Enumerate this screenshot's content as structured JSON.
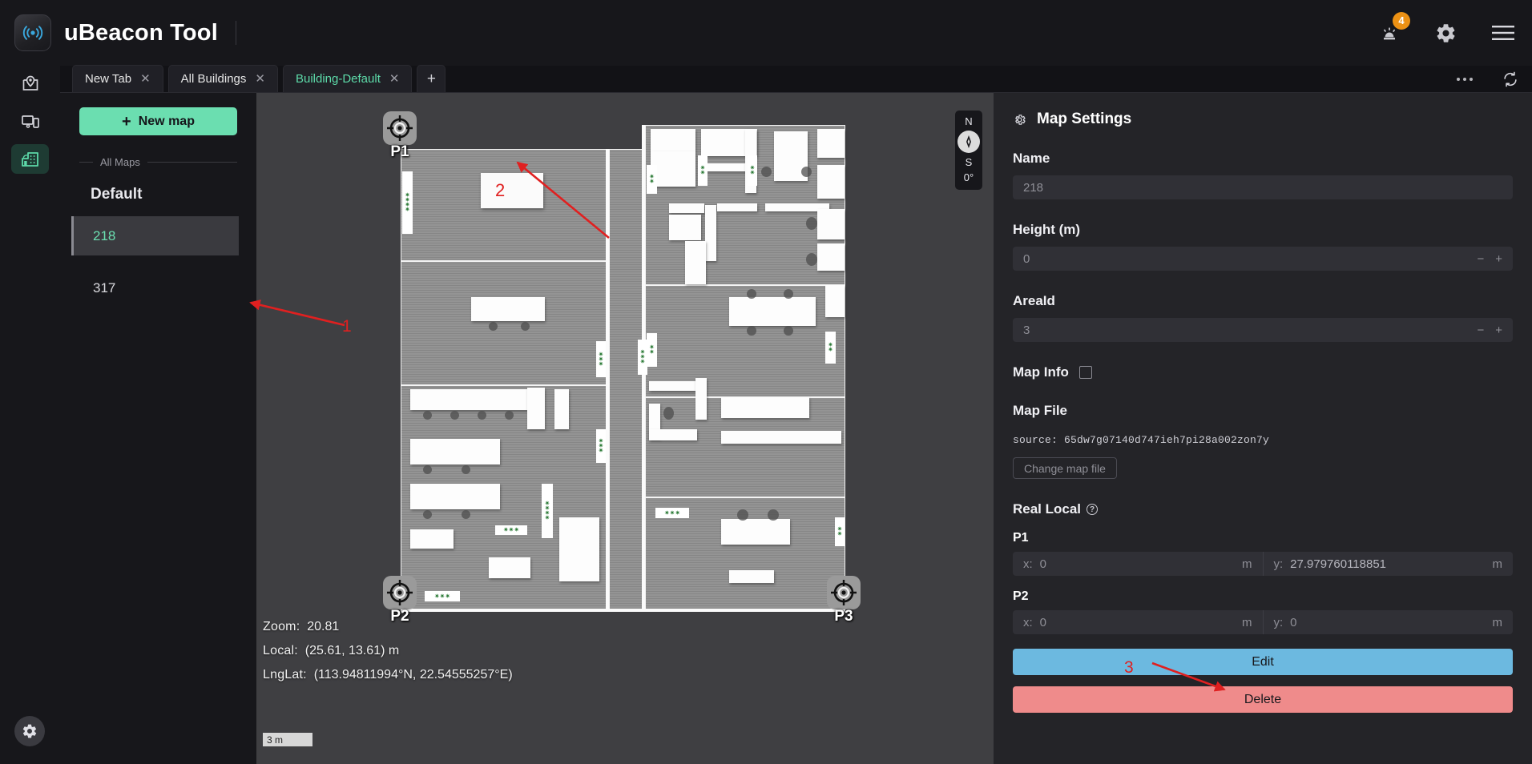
{
  "app": {
    "title": "uBeacon Tool",
    "logo_icon": "beacon-signal-icon",
    "alarm_icon": "alarm-siren-icon",
    "alarm_badge": "4",
    "settings_icon": "gear-icon",
    "menu_icon": "hamburger-menu-icon"
  },
  "rail": {
    "items": [
      {
        "name": "location",
        "icon": "map-pin-icon",
        "active": false
      },
      {
        "name": "devices",
        "icon": "devices-icon",
        "active": false
      },
      {
        "name": "buildings",
        "icon": "building-icon",
        "active": true
      }
    ],
    "bottom_icon": "gear-icon"
  },
  "tabs": {
    "items": [
      {
        "label": "New Tab",
        "active": false,
        "close_icon": "close-icon"
      },
      {
        "label": "All Buildings",
        "active": false,
        "close_icon": "close-icon"
      },
      {
        "label": "Building-Default",
        "active": true,
        "close_icon": "close-icon"
      }
    ],
    "add_label": "+",
    "more_icon": "more-dots-icon",
    "refresh_icon": "refresh-sync-icon"
  },
  "maps_panel": {
    "new_map_label": "New map",
    "new_map_icon": "plus-icon",
    "section_label": "All Maps",
    "group_title": "Default",
    "items": [
      {
        "label": "218",
        "selected": true
      },
      {
        "label": "317",
        "selected": false
      }
    ]
  },
  "map_canvas": {
    "readout": {
      "zoom_label": "Zoom:",
      "zoom_value": "20.81",
      "local_label": "Local:",
      "local_value": "(25.61, 13.61) m",
      "lnglat_label": "LngLat:",
      "lnglat_value": "(113.94811994°N, 22.54555257°E)"
    },
    "scale_bar": "3 m",
    "compass": {
      "north": "N",
      "south": "S",
      "angle": "0°",
      "icon": "compass-needle-icon"
    },
    "markers": [
      {
        "label": "P1",
        "icon": "crosshair-target-icon"
      },
      {
        "label": "P2",
        "icon": "crosshair-target-icon"
      },
      {
        "label": "P3",
        "icon": "crosshair-target-icon"
      }
    ]
  },
  "settings": {
    "title": "Map Settings",
    "title_icon": "gear-icon",
    "name_label": "Name",
    "name_value": "218",
    "height_label": "Height (m)",
    "height_value": "0",
    "areaid_label": "AreaId",
    "areaid_value": "3",
    "mapinfo_label": "Map Info",
    "mapinfo_checked": false,
    "mapfile_label": "Map File",
    "source_text": "source: 65dw7g07140d747ieh7pi28a002zon7y",
    "change_file_label": "Change map file",
    "real_local_label": "Real Local",
    "help_icon": "question-mark-icon",
    "points": [
      {
        "label": "P1",
        "x_prefix": "x:",
        "x_value": "0",
        "x_unit": "m",
        "y_prefix": "y:",
        "y_value": "27.979760118851",
        "y_unit": "m"
      },
      {
        "label": "P2",
        "x_prefix": "x:",
        "x_value": "0",
        "x_unit": "m",
        "y_prefix": "y:",
        "y_value": "0",
        "y_unit": "m"
      }
    ],
    "edit_label": "Edit",
    "delete_label": "Delete"
  },
  "annotations": [
    {
      "label": "1"
    },
    {
      "label": "2"
    },
    {
      "label": "3"
    }
  ],
  "colors": {
    "accent_green": "#6bdeb0",
    "badge_orange": "#ec9114",
    "edit_blue": "#6cb9e0",
    "delete_red": "#ef8b8b",
    "annotation_red": "#e02020"
  }
}
